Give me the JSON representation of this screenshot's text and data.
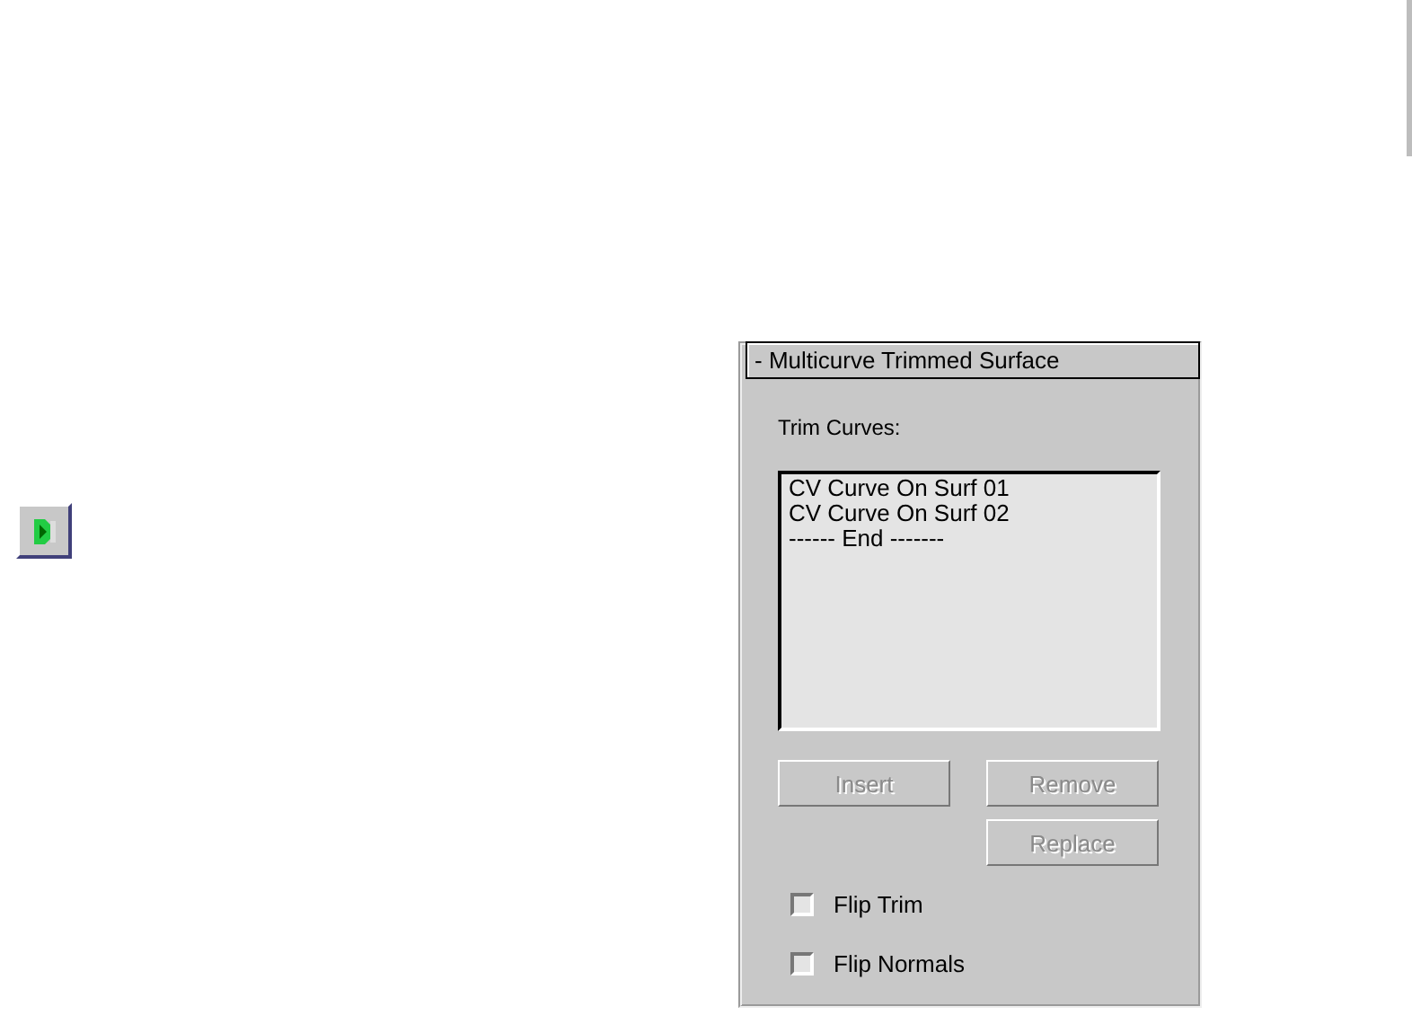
{
  "tool_button": {
    "kind": "icon"
  },
  "panel": {
    "title": "- Multicurve Trimmed Surface",
    "label": "Trim Curves:",
    "list_items": [
      "CV Curve On Surf 01",
      "CV Curve On Surf 02",
      "------ End -------"
    ],
    "buttons": [
      {
        "label": "Insert",
        "disabled": true
      },
      {
        "label": "Remove",
        "disabled": true
      },
      {
        "label": "Replace",
        "disabled": true
      }
    ],
    "checkboxes": [
      {
        "label": "Flip Trim",
        "checked": false
      },
      {
        "label": "Flip Normals",
        "checked": false
      }
    ]
  }
}
